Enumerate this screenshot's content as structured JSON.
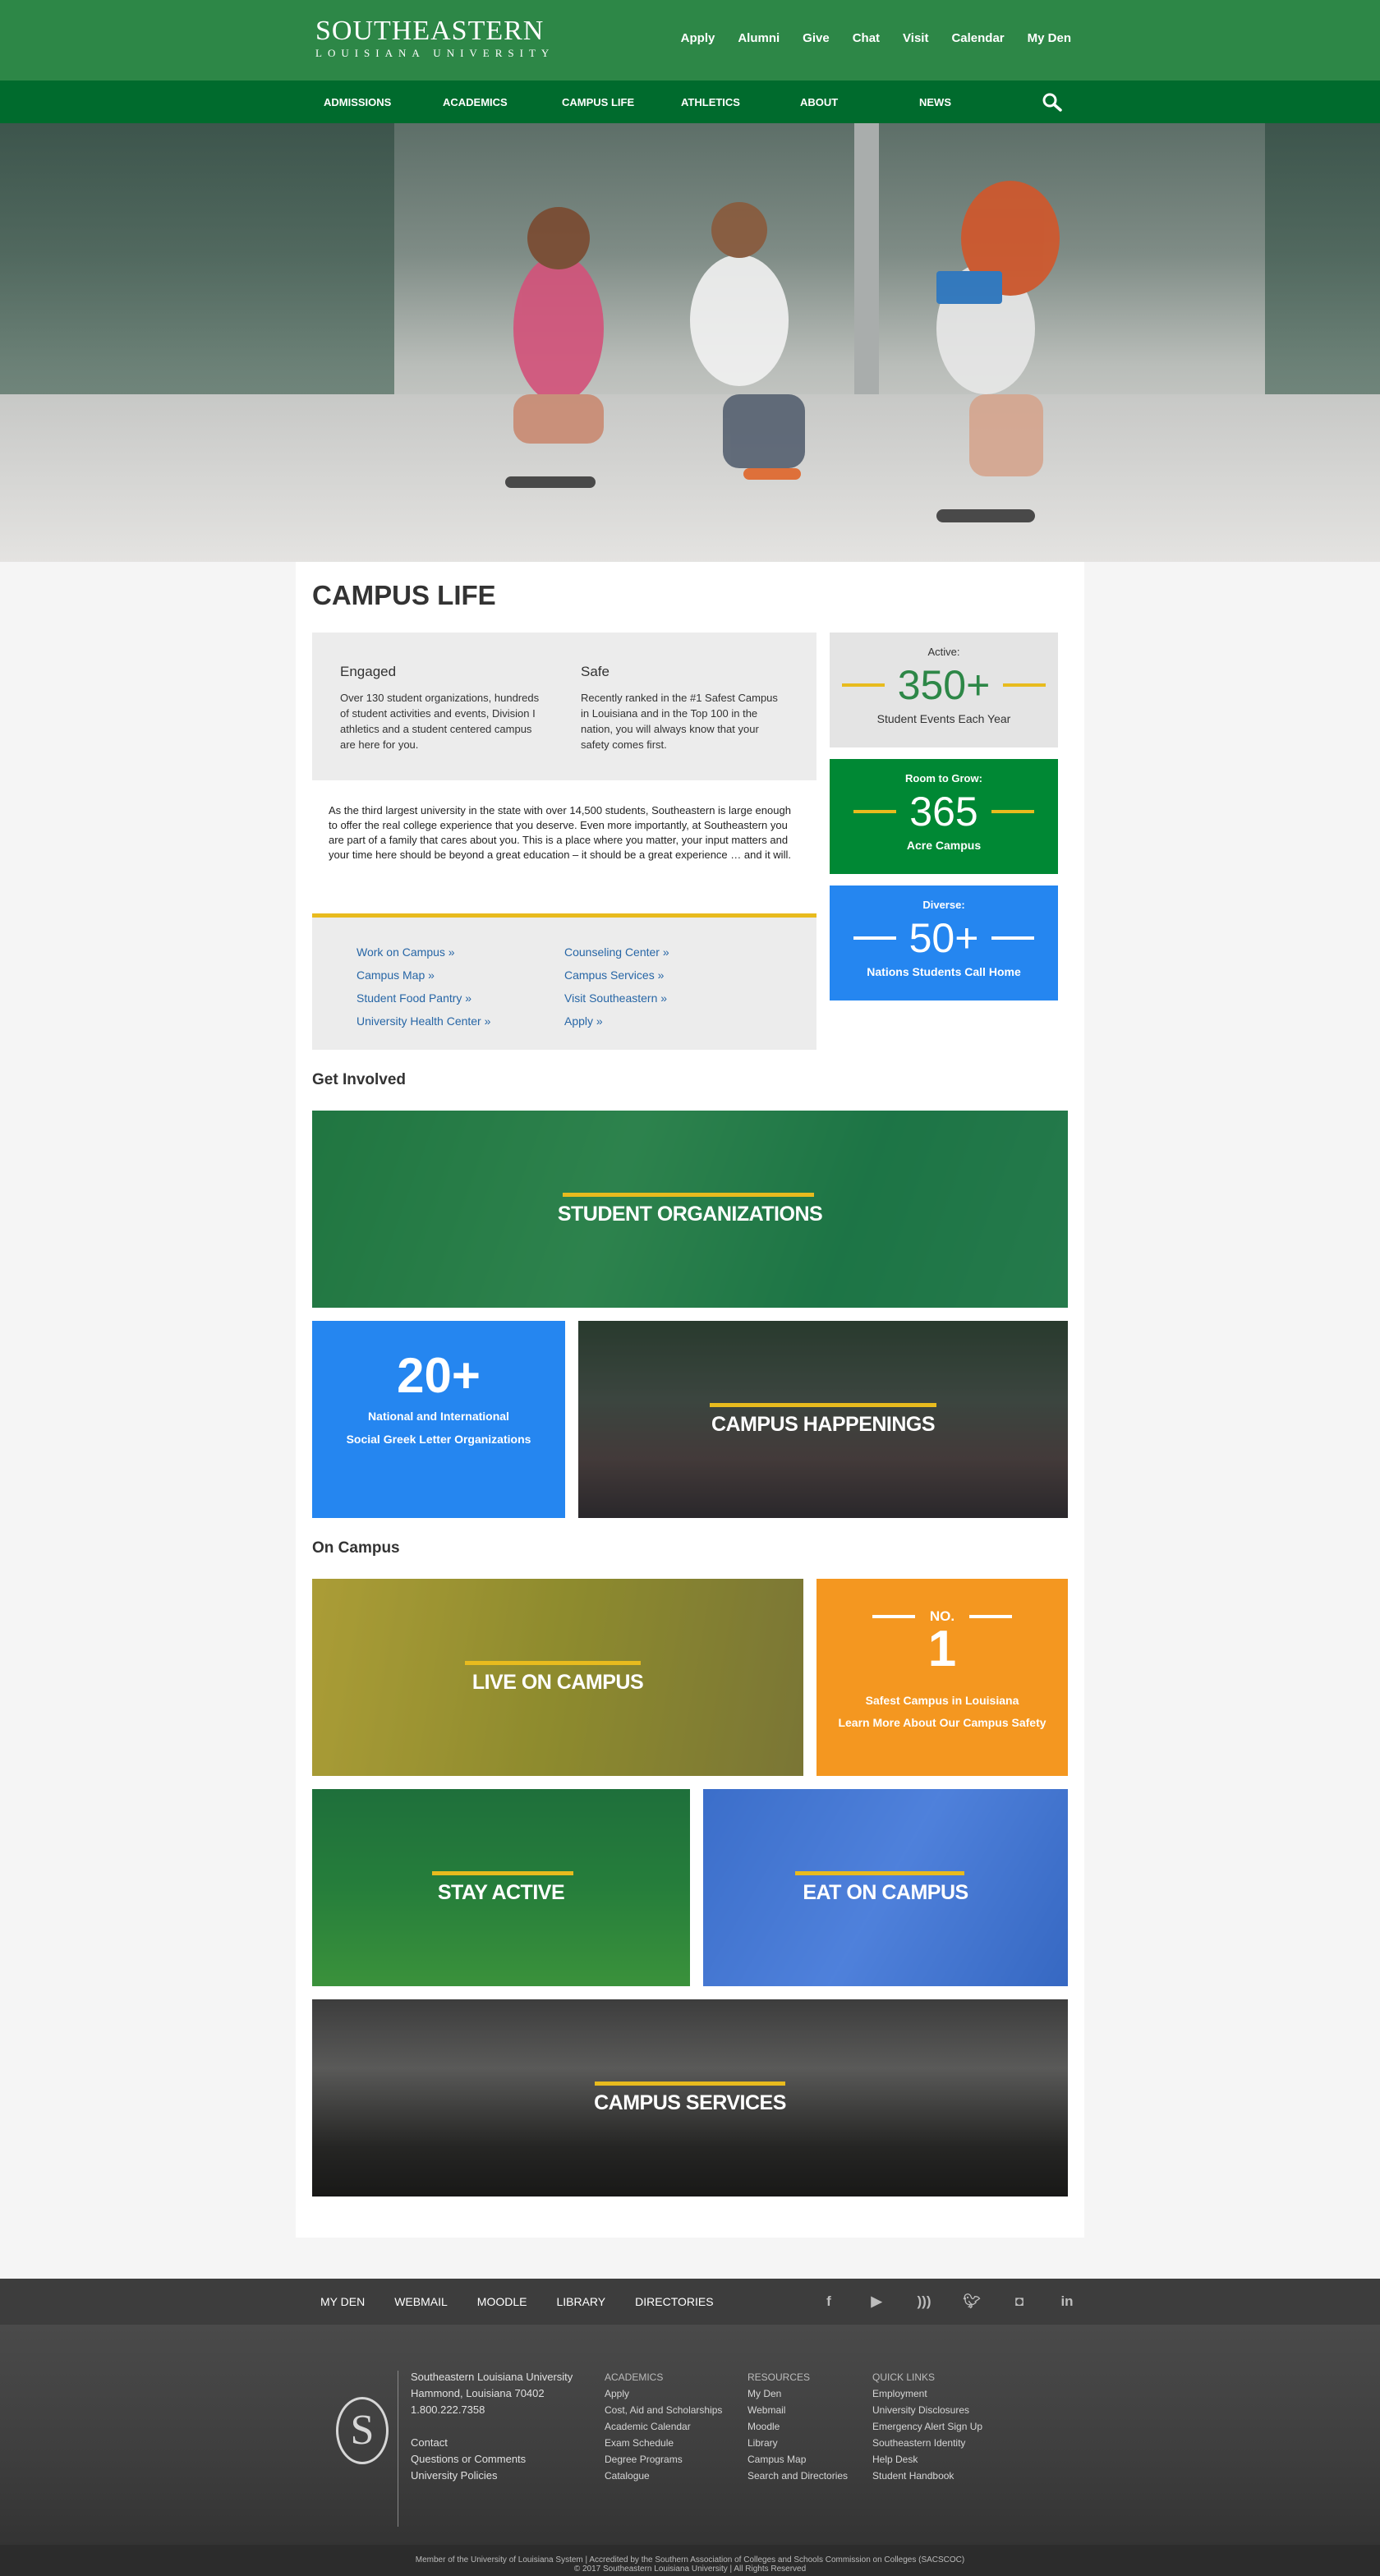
{
  "header": {
    "logo_line1": "SOUTHEASTERN",
    "logo_line2": "LOUISIANA UNIVERSITY",
    "util_links": [
      "Apply",
      "Alumni",
      "Give",
      "Chat",
      "Visit",
      "Calendar",
      "My Den"
    ],
    "nav": [
      "ADMISSIONS",
      "ACADEMICS",
      "CAMPUS LIFE",
      "ATHLETICS",
      "ABOUT",
      "NEWS"
    ]
  },
  "page": {
    "title": "CAMPUS LIFE",
    "engaged_h": "Engaged",
    "engaged_p": "Over 130 student organizations, hundreds of student activities and events, Division I athletics and a student centered campus are here for you.",
    "safe_h": "Safe",
    "safe_p": "Recently ranked in the #1 Safest Campus in Louisiana and in the Top 100 in the nation, you will always know that your safety comes first.",
    "intro": "As the third largest university in the state with over 14,500 students, Southeastern is large enough to offer the real college experience that you deserve. Even more importantly, at Southeastern you are part of a family that cares about you. This is a place where you matter, your input matters and your time here should be beyond a great education – it should be a great experience … and it will.",
    "links_left": [
      "Work on Campus »",
      "Campus Map »",
      "Student Food Pantry »",
      "University Health Center »"
    ],
    "links_right": [
      "Counseling Center »",
      "Campus Services »",
      "Visit Southeastern »",
      "Apply »"
    ]
  },
  "stats": [
    {
      "label": "Active:",
      "num": "350+",
      "desc": "Student Events Each Year"
    },
    {
      "label": "Room to Grow:",
      "num": "365",
      "desc": "Acre Campus"
    },
    {
      "label": "Diverse:",
      "num": "50+",
      "desc": "Nations Students Call Home"
    }
  ],
  "get_involved": {
    "heading": "Get Involved",
    "student_orgs": "STUDENT ORGANIZATIONS",
    "greek_num": "20+",
    "greek_line1": "National and International",
    "greek_line2": "Social Greek Letter Organizations",
    "happenings": "CAMPUS HAPPENINGS"
  },
  "on_campus": {
    "heading": "On Campus",
    "live": "LIVE ON CAMPUS",
    "no_label": "NO.",
    "no_num": "1",
    "safest": "Safest Campus in Louisiana",
    "learn_more": "Learn More About Our Campus Safety",
    "stay_active": "STAY ACTIVE",
    "eat": "EAT ON CAMPUS",
    "services": "CAMPUS SERVICES"
  },
  "footer": {
    "links": [
      "MY DEN",
      "WEBMAIL",
      "MOODLE",
      "LIBRARY",
      "DIRECTORIES"
    ],
    "socials": [
      "facebook-icon",
      "youtube-icon",
      "rss-icon",
      "twitter-icon",
      "instagram-icon",
      "linkedin-icon"
    ],
    "seal_letter": "S",
    "address": [
      "Southeastern Louisiana University",
      "Hammond, Louisiana 70402",
      "1.800.222.7358"
    ],
    "address_links": [
      "Contact",
      "Questions or Comments",
      "University Policies"
    ],
    "academics_h": "ACADEMICS",
    "academics": [
      "Apply",
      "Cost, Aid and Scholarships",
      "Academic Calendar",
      "Exam Schedule",
      "Degree Programs",
      "Catalogue"
    ],
    "resources_h": "RESOURCES",
    "resources": [
      "My Den",
      "Webmail",
      "Moodle",
      "Library",
      "Campus Map",
      "Search and Directories"
    ],
    "quick_h": "QUICK LINKS",
    "quick": [
      "Employment",
      "University Disclosures",
      "Emergency Alert Sign Up",
      "Southeastern Identity",
      "Help Desk",
      "Student Handbook"
    ],
    "legal1": "Member of the University of Louisiana System  |  Accredited by the Southern Association of Colleges and Schools Commission on Colleges (SACSCOC)",
    "legal2": "© 2017 Southeastern Louisiana University  |  All Rights Reserved"
  },
  "colors": {
    "brand_green": "#2d8747",
    "nav_green": "#006b2d",
    "accent_gold": "#e8bb1e",
    "blue": "#2586f0",
    "orange": "#f49720"
  }
}
